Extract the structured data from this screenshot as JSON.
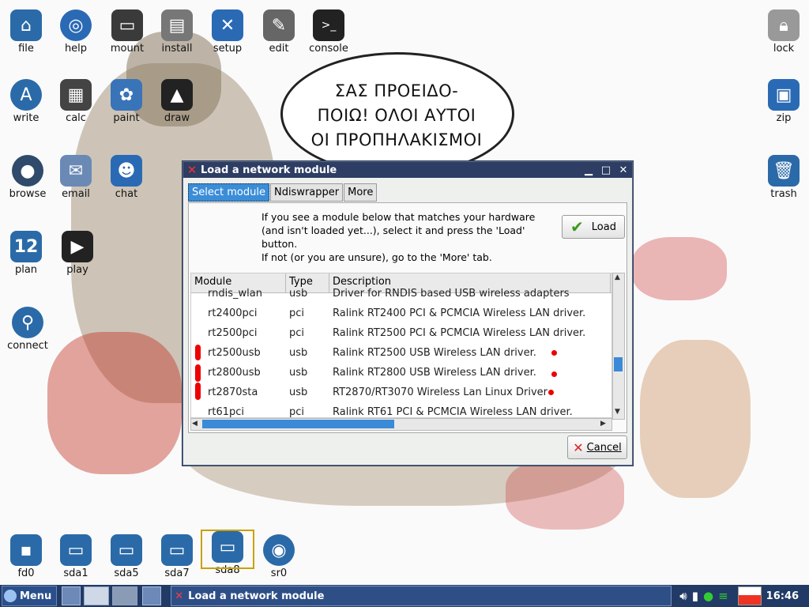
{
  "wallpaper": {
    "speech_lines": [
      "ΣΑΣ ΠΡΟΕΙΔΟ-",
      "ΠΟΙΩ! ΟΛΟΙ ΑΥΤΟΙ",
      "ΟΙ ΠΡΟΠΗΛΑΚΙΣΜΟΙ"
    ]
  },
  "desktop_icons": [
    {
      "label": "file",
      "icon": "home-folder-icon",
      "color": "#2b6aa8"
    },
    {
      "label": "help",
      "icon": "lifebuoy-icon",
      "color": "#2a6ab5"
    },
    {
      "label": "mount",
      "icon": "drive-icon",
      "color": "#3a3a3a"
    },
    {
      "label": "install",
      "icon": "box-install-icon",
      "color": "#555"
    },
    {
      "label": "setup",
      "icon": "tools-icon",
      "color": "#2a6ab5"
    },
    {
      "label": "edit",
      "icon": "notepad-icon",
      "color": "#444"
    },
    {
      "label": "console",
      "icon": "terminal-icon",
      "color": "#222"
    },
    {
      "label": "write",
      "icon": "write-icon",
      "color": "#2b6aa8"
    },
    {
      "label": "calc",
      "icon": "calculator-icon",
      "color": "#333"
    },
    {
      "label": "paint",
      "icon": "palette-icon",
      "color": "#3a74b8"
    },
    {
      "label": "draw",
      "icon": "draw-icon",
      "color": "#222"
    },
    {
      "label": "browse",
      "icon": "globe-icon",
      "color": "#2f4a6a"
    },
    {
      "label": "email",
      "icon": "envelope-icon",
      "color": "#6a8ab5"
    },
    {
      "label": "chat",
      "icon": "chat-people-icon",
      "color": "#2a6ab5"
    },
    {
      "label": "plan",
      "icon": "calendar-icon",
      "color": "#2b6aa8"
    },
    {
      "label": "play",
      "icon": "clapperboard-icon",
      "color": "#222"
    },
    {
      "label": "connect",
      "icon": "connect-icon",
      "color": "#2b6aa8"
    },
    {
      "label": "lock",
      "icon": "padlock-icon",
      "color": "#888"
    },
    {
      "label": "zip",
      "icon": "zip-archive-icon",
      "color": "#2a6ab5"
    },
    {
      "label": "trash",
      "icon": "trash-can-icon",
      "color": "#2b6aa8"
    },
    {
      "label": "fd0",
      "icon": "floppy-icon",
      "color": "#2b6aa8"
    },
    {
      "label": "sda1",
      "icon": "drive-icon",
      "color": "#2b6aa8"
    },
    {
      "label": "sda5",
      "icon": "drive-icon",
      "color": "#2b6aa8"
    },
    {
      "label": "sda7",
      "icon": "drive-icon",
      "color": "#2b6aa8"
    },
    {
      "label": "sda8",
      "icon": "drive-icon",
      "color": "#2b6aa8"
    },
    {
      "label": "sr0",
      "icon": "optical-disc-icon",
      "color": "#2b6aa8"
    }
  ],
  "dialog": {
    "title": "Load a network module",
    "tabs": [
      "Select module",
      "Ndiswrapper",
      "More"
    ],
    "info_lines": [
      "If you see a module below that matches your hardware",
      "(and isn't loaded yet...), select it and press the 'Load'",
      "button.",
      "If not (or you are unsure), go to the 'More' tab."
    ],
    "load_label": "Load",
    "cancel_label": "Cancel",
    "columns": [
      "Module",
      "Type",
      "Description"
    ],
    "rows": [
      {
        "module": "rndis_wlan",
        "type": "usb",
        "desc": "Driver for RNDIS based USB wireless adapters"
      },
      {
        "module": "rt2400pci",
        "type": "pci",
        "desc": "Ralink RT2400 PCI & PCMCIA Wireless LAN driver."
      },
      {
        "module": "rt2500pci",
        "type": "pci",
        "desc": "Ralink RT2500 PCI & PCMCIA Wireless LAN driver."
      },
      {
        "module": "rt2500usb",
        "type": "usb",
        "desc": "Ralink RT2500 USB Wireless LAN driver."
      },
      {
        "module": "rt2800usb",
        "type": "usb",
        "desc": "Ralink RT2800 USB Wireless LAN driver."
      },
      {
        "module": "rt2870sta",
        "type": "usb",
        "desc": "RT2870/RT3070 Wireless Lan Linux Driver"
      },
      {
        "module": "rt61pci",
        "type": "pci",
        "desc": "Ralink RT61 PCI & PCMCIA Wireless LAN driver."
      }
    ]
  },
  "taskbar": {
    "menu_label": "Menu",
    "task_title": "Load a network module",
    "clock": "16:46"
  }
}
